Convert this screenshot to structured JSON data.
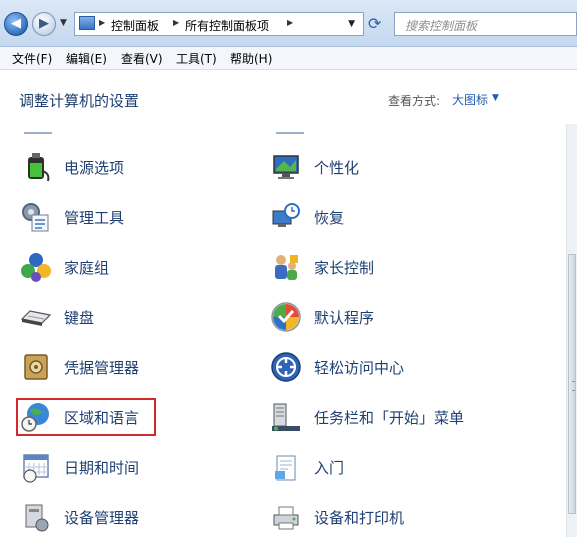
{
  "address_bar": {
    "breadcrumbs": [
      "控制面板",
      "所有控制面板项"
    ],
    "search_placeholder": "搜索控制面板"
  },
  "menu": [
    "文件(F)",
    "编辑(E)",
    "查看(V)",
    "工具(T)",
    "帮助(H)"
  ],
  "header": {
    "title": "调整计算机的设置",
    "view_by_label": "查看方式:",
    "view_by_value": "大图标"
  },
  "items_left": [
    {
      "label": "电源选项",
      "icon": "battery-plug-icon"
    },
    {
      "label": "管理工具",
      "icon": "admin-tools-icon"
    },
    {
      "label": "家庭组",
      "icon": "homegroup-icon"
    },
    {
      "label": "键盘",
      "icon": "keyboard-icon"
    },
    {
      "label": "凭据管理器",
      "icon": "credential-safe-icon"
    },
    {
      "label": "区域和语言",
      "icon": "globe-clock-icon"
    },
    {
      "label": "日期和时间",
      "icon": "calendar-clock-icon"
    },
    {
      "label": "设备管理器",
      "icon": "device-manager-icon"
    }
  ],
  "items_right": [
    {
      "label": "个性化",
      "icon": "personalize-monitor-icon"
    },
    {
      "label": "恢复",
      "icon": "recovery-icon"
    },
    {
      "label": "家长控制",
      "icon": "parental-control-icon"
    },
    {
      "label": "默认程序",
      "icon": "default-programs-icon"
    },
    {
      "label": "轻松访问中心",
      "icon": "ease-of-access-icon"
    },
    {
      "label": "任务栏和「开始」菜单",
      "icon": "taskbar-icon"
    },
    {
      "label": "入门",
      "icon": "getting-started-icon"
    },
    {
      "label": "设备和打印机",
      "icon": "printer-icon"
    }
  ],
  "highlighted_item": "区域和语言",
  "colors": {
    "link_text": "#1e3f72",
    "highlight_box": "#d12a2a",
    "accent": "#1f5cb8"
  }
}
